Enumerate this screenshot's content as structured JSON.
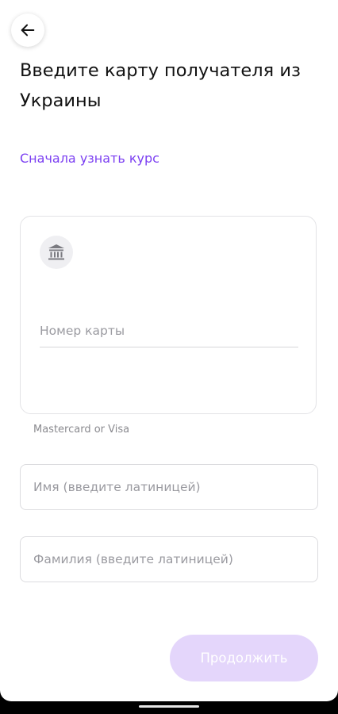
{
  "header": {
    "back_icon": "arrow-left-icon",
    "title": "Введите карту получателя из Украины"
  },
  "rate_link": "Сначала узнать курс",
  "card": {
    "icon": "bank-icon",
    "placeholder": "Номер карты",
    "hint": "Mastercard or Visa"
  },
  "first_name": {
    "placeholder": "Имя (введите латиницей)"
  },
  "last_name": {
    "placeholder": "Фамилия (введите латиницей)"
  },
  "continue_label": "Продолжить",
  "colors": {
    "accent": "#7b3ff2",
    "button_disabled": "#e4d6fb",
    "field_border": "#dcdcdf"
  }
}
